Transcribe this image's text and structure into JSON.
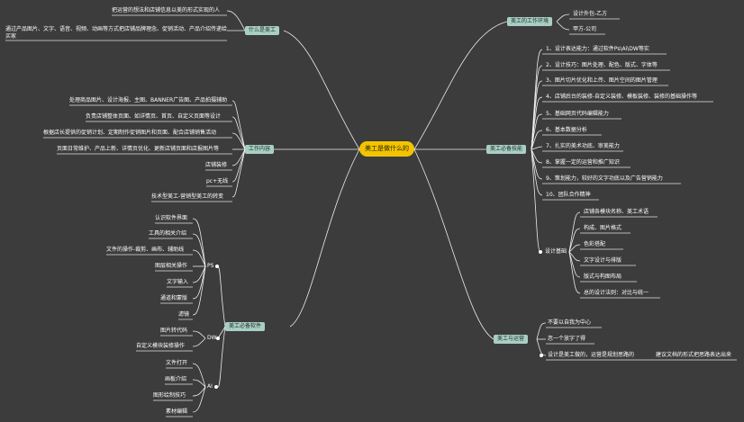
{
  "root": "美工是做什么的",
  "branches": {
    "what_is": {
      "label": "什么是美工",
      "items": [
        "把运营的想法和店铺信息以美的形式实现的人",
        "通过产品图片、文字、语音、视频、动画等方式把店铺品牌理念、促销活动、产品介绍传递给买家"
      ]
    },
    "work_content": {
      "label": "工作内容",
      "items": [
        "处理商品图片、设计海报、主图、BANNER广告图、产品拍摄辅助",
        "负责店铺整体页面、如详情页、首页、自定义页面等设计",
        "根据店长提供的促销计划、定期制作促销图片和页面、配合店铺销售活动",
        "页面日常维护、产品上新、详情页优化、更新店铺页面和店报图片等",
        "店铺装修",
        "pc+无线",
        "技术型美工-营销型美工的转变"
      ]
    },
    "software": {
      "label": "美工必备软件",
      "ps": {
        "label": "PS",
        "items": [
          "认识软件界面",
          "工具的相关介绍",
          "文件的操作-裁剪、画布、辅助线",
          "图层相关操作",
          "文字输入",
          "通道和蒙版",
          "滤镜"
        ]
      },
      "dw": {
        "label": "DW",
        "items": [
          "图片转代码",
          "自定义模块装修操作"
        ]
      },
      "ai": {
        "label": "AI",
        "items": [
          "文件打开",
          "画板介绍",
          "图形绘制技巧",
          "素材编辑"
        ]
      }
    },
    "environment": {
      "label": "美工的工作环境",
      "items": [
        "设计外包-乙方",
        "甲方-公司"
      ]
    },
    "skills": {
      "label": "美工必备技能",
      "items": [
        "1、设计表达能力：通过软件Ps\\Ai\\DW等实",
        "2、设计技巧：图片处理、配色、版式、字体等",
        "3、图片切片优化和上传、图片空间的图片管理",
        "4、店铺后台的装修-自定义装修、模板装修、装修的基础操作等",
        "5、基础网页代码编辑能力",
        "6、基本数据分析",
        "7、扎实的美术功底、审美能力",
        "8、掌握一定的运营和推广知识",
        "9、策划能力，较好的文字功底以及广告营销能力",
        "10、团队合作精神"
      ],
      "basics": {
        "label": "设计基础",
        "items": [
          "店铺各模块名称、美工术语",
          "构成、图片格式",
          "色彩搭配",
          "文字设计与排版",
          "版式与构图布局",
          "总的设计法则：对比与统一"
        ]
      }
    },
    "operations": {
      "label": "美工与运营",
      "items": [
        "不要以自我为中心",
        "忽一个放字了得",
        "设计是美工做的，运营是规划思路的"
      ],
      "extra": "建议文档的形式把思路表达出来"
    }
  },
  "colors": {
    "background": "#3c3c3c",
    "line": "#ffffff",
    "root_fill": "#f2c400",
    "branch_fill": "#a9cfc4"
  }
}
